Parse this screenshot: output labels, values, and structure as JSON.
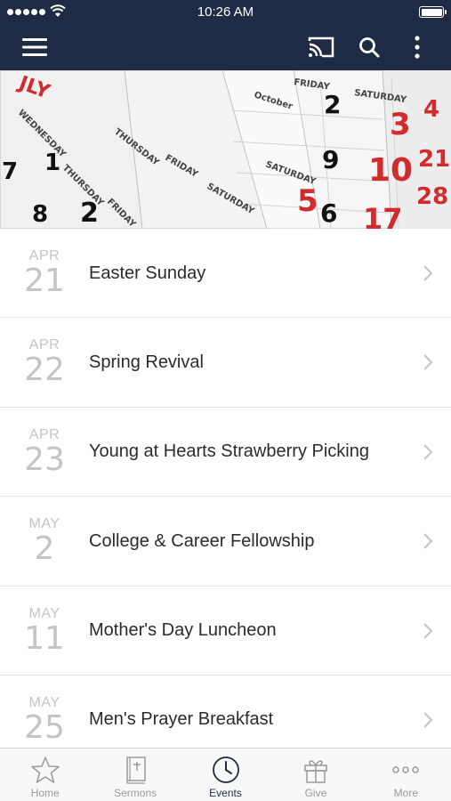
{
  "status_bar": {
    "time": "10:26 AM"
  },
  "hero": {
    "calendar_text": [
      "OCTOBER",
      "FRIDAY",
      "SATURDAY",
      "THURSDAY",
      "WEDNESDAY",
      "3",
      "4",
      "10",
      "17",
      "5",
      "8",
      "2",
      "1",
      "7"
    ]
  },
  "events": [
    {
      "month": "APR",
      "day": "21",
      "title": "Easter Sunday"
    },
    {
      "month": "APR",
      "day": "22",
      "title": "Spring Revival"
    },
    {
      "month": "APR",
      "day": "23",
      "title": "Young at Hearts Strawberry Picking"
    },
    {
      "month": "MAY",
      "day": "2",
      "title": "College & Career Fellowship"
    },
    {
      "month": "MAY",
      "day": "11",
      "title": "Mother's Day Luncheon"
    },
    {
      "month": "MAY",
      "day": "25",
      "title": "Men's Prayer Breakfast"
    }
  ],
  "tab_bar": {
    "tabs": [
      {
        "label": "Home",
        "icon": "star-icon",
        "active": false
      },
      {
        "label": "Sermons",
        "icon": "bible-icon",
        "active": false
      },
      {
        "label": "Events",
        "icon": "clock-icon",
        "active": true
      },
      {
        "label": "Give",
        "icon": "gift-icon",
        "active": false
      },
      {
        "label": "More",
        "icon": "ellipsis-icon",
        "active": false
      }
    ]
  },
  "colors": {
    "header_bg": "#1f2a44",
    "date_text": "#c4c4c4",
    "title_text": "#2b2b2b",
    "tab_inactive": "#9a9a9a",
    "tab_active": "#1f2a44",
    "calendar_red": "#d22b2b"
  }
}
